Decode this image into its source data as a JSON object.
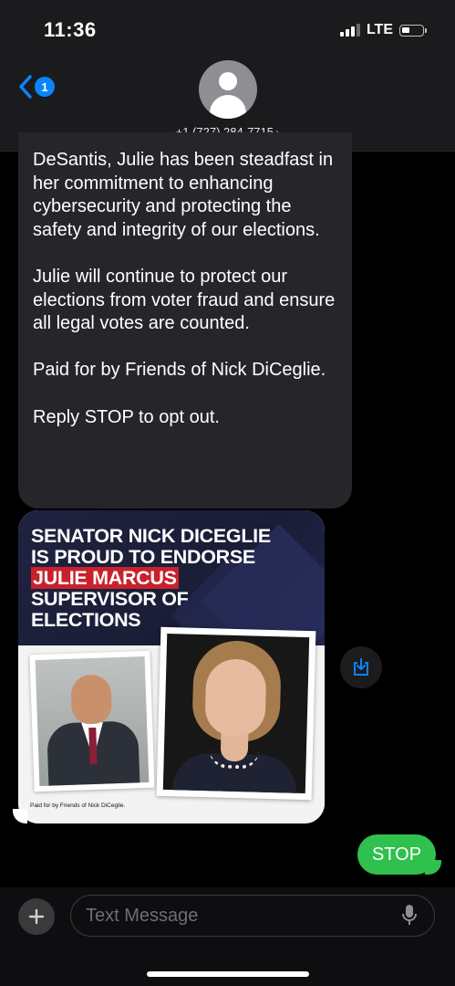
{
  "status": {
    "time": "11:36",
    "network": "LTE"
  },
  "header": {
    "back_badge": "1",
    "contact_number": "+1 (727) 284-7715",
    "contact_chevron": "›"
  },
  "messages": {
    "incoming_paragraphs": [
      "DeSantis, Julie has been steadfast in her commitment to enhancing cybersecurity and protecting the safety and integrity of our elections.",
      "Julie will continue to protect our elections from voter fraud and ensure all legal votes are counted.",
      "Paid for by Friends of Nick DiCeglie.",
      "Reply STOP to opt out."
    ],
    "image": {
      "line1": "SENATOR NICK DICEGLIE",
      "line2": "IS PROUD TO ENDORSE",
      "line3": "JULIE MARCUS",
      "line4": "SUPERVISOR OF",
      "line5": "ELECTIONS",
      "disclaimer": "Paid for by Friends of Nick DiCeglie."
    },
    "outgoing": "STOP"
  },
  "composer": {
    "placeholder": "Text Message"
  },
  "icons": [
    "back-chevron-icon",
    "contact-avatar-icon",
    "save-download-icon",
    "plus-icon",
    "microphone-icon"
  ],
  "colors": {
    "accent_blue": "#0a84ff",
    "sent_green": "#30c04d",
    "received_gray": "#26252a",
    "highlight_red": "#c9212c"
  }
}
